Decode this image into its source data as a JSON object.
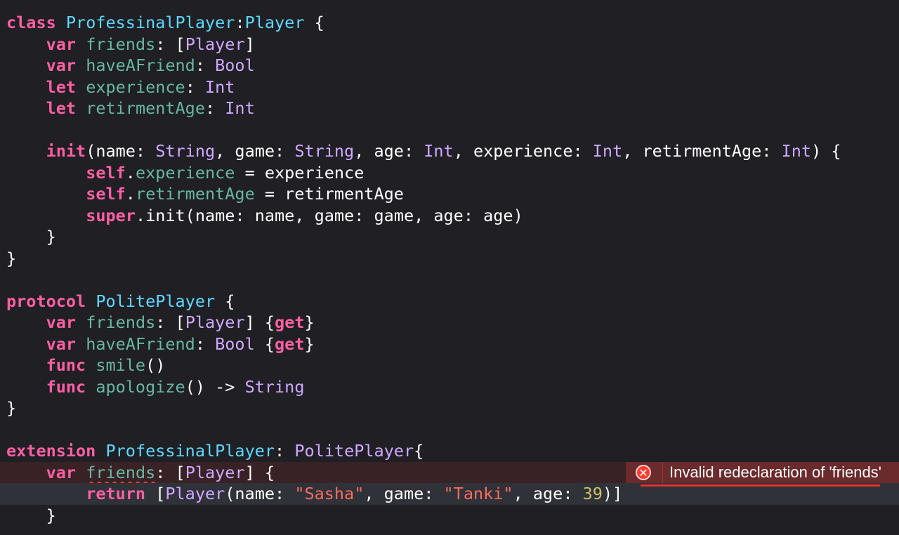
{
  "code_lines": [
    [
      [
        "kw",
        "class"
      ],
      [
        "plain",
        " "
      ],
      [
        "type-decl",
        "ProfessinalPlayer"
      ],
      [
        "plain",
        ":"
      ],
      [
        "type-decl",
        "Player"
      ],
      [
        "plain",
        " {"
      ]
    ],
    [
      [
        "plain",
        "    "
      ],
      [
        "kw",
        "var"
      ],
      [
        "plain",
        " "
      ],
      [
        "prop",
        "friends"
      ],
      [
        "plain",
        ": ["
      ],
      [
        "type-ref",
        "Player"
      ],
      [
        "plain",
        "]"
      ]
    ],
    [
      [
        "plain",
        "    "
      ],
      [
        "kw",
        "var"
      ],
      [
        "plain",
        " "
      ],
      [
        "prop",
        "haveAFriend"
      ],
      [
        "plain",
        ": "
      ],
      [
        "type-ref",
        "Bool"
      ]
    ],
    [
      [
        "plain",
        "    "
      ],
      [
        "kw",
        "let"
      ],
      [
        "plain",
        " "
      ],
      [
        "prop",
        "experience"
      ],
      [
        "plain",
        ": "
      ],
      [
        "type-ref",
        "Int"
      ]
    ],
    [
      [
        "plain",
        "    "
      ],
      [
        "kw",
        "let"
      ],
      [
        "plain",
        " "
      ],
      [
        "prop",
        "retirmentAge"
      ],
      [
        "plain",
        ": "
      ],
      [
        "type-ref",
        "Int"
      ]
    ],
    [],
    [
      [
        "plain",
        "    "
      ],
      [
        "kw",
        "init"
      ],
      [
        "plain",
        "(name: "
      ],
      [
        "type-ref",
        "String"
      ],
      [
        "plain",
        ", game: "
      ],
      [
        "type-ref",
        "String"
      ],
      [
        "plain",
        ", age: "
      ],
      [
        "type-ref",
        "Int"
      ],
      [
        "plain",
        ", experience: "
      ],
      [
        "type-ref",
        "Int"
      ],
      [
        "plain",
        ", retirmentAge: "
      ],
      [
        "type-ref",
        "Int"
      ],
      [
        "plain",
        ") {"
      ]
    ],
    [
      [
        "plain",
        "        "
      ],
      [
        "kw",
        "self"
      ],
      [
        "plain",
        "."
      ],
      [
        "prop",
        "experience"
      ],
      [
        "plain",
        " = experience"
      ]
    ],
    [
      [
        "plain",
        "        "
      ],
      [
        "kw",
        "self"
      ],
      [
        "plain",
        "."
      ],
      [
        "prop",
        "retirmentAge"
      ],
      [
        "plain",
        " = retirmentAge"
      ]
    ],
    [
      [
        "plain",
        "        "
      ],
      [
        "kw",
        "super"
      ],
      [
        "plain",
        ".init(name: name, game: game, age: age)"
      ]
    ],
    [
      [
        "plain",
        "    }"
      ]
    ],
    [
      [
        "plain",
        "}"
      ]
    ],
    [],
    [
      [
        "kw",
        "protocol"
      ],
      [
        "plain",
        " "
      ],
      [
        "type-decl",
        "PolitePlayer"
      ],
      [
        "plain",
        " {"
      ]
    ],
    [
      [
        "plain",
        "    "
      ],
      [
        "kw",
        "var"
      ],
      [
        "plain",
        " "
      ],
      [
        "prop",
        "friends"
      ],
      [
        "plain",
        ": ["
      ],
      [
        "type-ref",
        "Player"
      ],
      [
        "plain",
        "] {"
      ],
      [
        "kw",
        "get"
      ],
      [
        "plain",
        "}"
      ]
    ],
    [
      [
        "plain",
        "    "
      ],
      [
        "kw",
        "var"
      ],
      [
        "plain",
        " "
      ],
      [
        "prop",
        "haveAFriend"
      ],
      [
        "plain",
        ": "
      ],
      [
        "type-ref",
        "Bool"
      ],
      [
        "plain",
        " {"
      ],
      [
        "kw",
        "get"
      ],
      [
        "plain",
        "}"
      ]
    ],
    [
      [
        "plain",
        "    "
      ],
      [
        "kw",
        "func"
      ],
      [
        "plain",
        " "
      ],
      [
        "func",
        "smile"
      ],
      [
        "plain",
        "()"
      ]
    ],
    [
      [
        "plain",
        "    "
      ],
      [
        "kw",
        "func"
      ],
      [
        "plain",
        " "
      ],
      [
        "func",
        "apologize"
      ],
      [
        "plain",
        "() -> "
      ],
      [
        "type-ref",
        "String"
      ]
    ],
    [
      [
        "plain",
        "}"
      ]
    ],
    [],
    [
      [
        "kw",
        "extension"
      ],
      [
        "plain",
        " "
      ],
      [
        "type-decl",
        "ProfessinalPlayer"
      ],
      [
        "plain",
        ": "
      ],
      [
        "type-ref",
        "PolitePlayer"
      ],
      [
        "plain",
        "{"
      ]
    ],
    [
      [
        "plain",
        "    "
      ],
      [
        "kw",
        "var"
      ],
      [
        "plain",
        " "
      ],
      [
        "prop-err",
        "friends"
      ],
      [
        "plain",
        ": ["
      ],
      [
        "type-ref",
        "Player"
      ],
      [
        "plain",
        "] {"
      ]
    ],
    [
      [
        "plain",
        "        "
      ],
      [
        "kw",
        "return"
      ],
      [
        "plain",
        " ["
      ],
      [
        "type-ref",
        "Player"
      ],
      [
        "plain",
        "(name: "
      ],
      [
        "str",
        "\"Sasha\""
      ],
      [
        "plain",
        ", game: "
      ],
      [
        "str",
        "\"Tanki\""
      ],
      [
        "plain",
        ", age: "
      ],
      [
        "num",
        "39"
      ],
      [
        "plain",
        ")]"
      ]
    ],
    [
      [
        "plain",
        "    }"
      ]
    ]
  ],
  "error_line_index": 21,
  "current_line_index": 22,
  "error": {
    "message": "Invalid redeclaration of 'friends'",
    "icon": "error-x-circle-icon",
    "color": "#ff3b30"
  }
}
